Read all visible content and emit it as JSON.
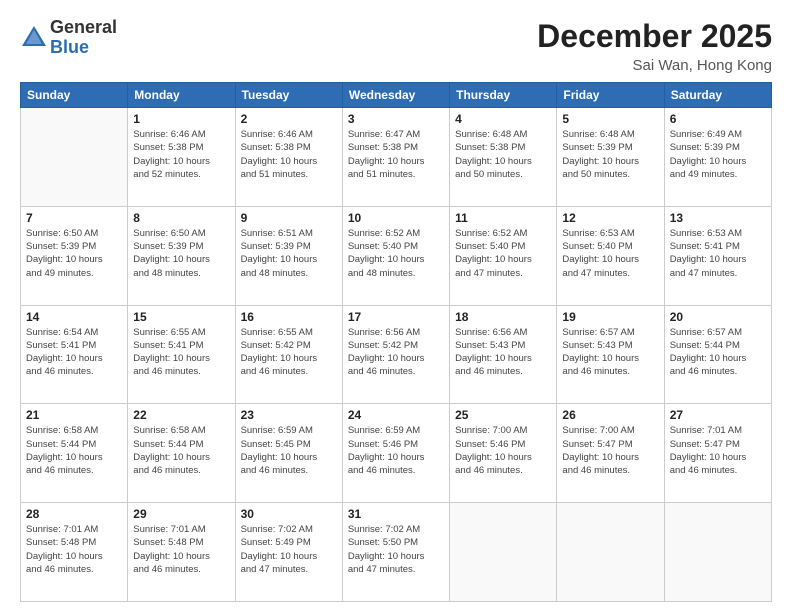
{
  "header": {
    "logo_general": "General",
    "logo_blue": "Blue",
    "month_title": "December 2025",
    "location": "Sai Wan, Hong Kong"
  },
  "calendar": {
    "days_of_week": [
      "Sunday",
      "Monday",
      "Tuesday",
      "Wednesday",
      "Thursday",
      "Friday",
      "Saturday"
    ],
    "weeks": [
      [
        {
          "day": "",
          "info": ""
        },
        {
          "day": "1",
          "info": "Sunrise: 6:46 AM\nSunset: 5:38 PM\nDaylight: 10 hours\nand 52 minutes."
        },
        {
          "day": "2",
          "info": "Sunrise: 6:46 AM\nSunset: 5:38 PM\nDaylight: 10 hours\nand 51 minutes."
        },
        {
          "day": "3",
          "info": "Sunrise: 6:47 AM\nSunset: 5:38 PM\nDaylight: 10 hours\nand 51 minutes."
        },
        {
          "day": "4",
          "info": "Sunrise: 6:48 AM\nSunset: 5:38 PM\nDaylight: 10 hours\nand 50 minutes."
        },
        {
          "day": "5",
          "info": "Sunrise: 6:48 AM\nSunset: 5:39 PM\nDaylight: 10 hours\nand 50 minutes."
        },
        {
          "day": "6",
          "info": "Sunrise: 6:49 AM\nSunset: 5:39 PM\nDaylight: 10 hours\nand 49 minutes."
        }
      ],
      [
        {
          "day": "7",
          "info": "Sunrise: 6:50 AM\nSunset: 5:39 PM\nDaylight: 10 hours\nand 49 minutes."
        },
        {
          "day": "8",
          "info": "Sunrise: 6:50 AM\nSunset: 5:39 PM\nDaylight: 10 hours\nand 48 minutes."
        },
        {
          "day": "9",
          "info": "Sunrise: 6:51 AM\nSunset: 5:39 PM\nDaylight: 10 hours\nand 48 minutes."
        },
        {
          "day": "10",
          "info": "Sunrise: 6:52 AM\nSunset: 5:40 PM\nDaylight: 10 hours\nand 48 minutes."
        },
        {
          "day": "11",
          "info": "Sunrise: 6:52 AM\nSunset: 5:40 PM\nDaylight: 10 hours\nand 47 minutes."
        },
        {
          "day": "12",
          "info": "Sunrise: 6:53 AM\nSunset: 5:40 PM\nDaylight: 10 hours\nand 47 minutes."
        },
        {
          "day": "13",
          "info": "Sunrise: 6:53 AM\nSunset: 5:41 PM\nDaylight: 10 hours\nand 47 minutes."
        }
      ],
      [
        {
          "day": "14",
          "info": "Sunrise: 6:54 AM\nSunset: 5:41 PM\nDaylight: 10 hours\nand 46 minutes."
        },
        {
          "day": "15",
          "info": "Sunrise: 6:55 AM\nSunset: 5:41 PM\nDaylight: 10 hours\nand 46 minutes."
        },
        {
          "day": "16",
          "info": "Sunrise: 6:55 AM\nSunset: 5:42 PM\nDaylight: 10 hours\nand 46 minutes."
        },
        {
          "day": "17",
          "info": "Sunrise: 6:56 AM\nSunset: 5:42 PM\nDaylight: 10 hours\nand 46 minutes."
        },
        {
          "day": "18",
          "info": "Sunrise: 6:56 AM\nSunset: 5:43 PM\nDaylight: 10 hours\nand 46 minutes."
        },
        {
          "day": "19",
          "info": "Sunrise: 6:57 AM\nSunset: 5:43 PM\nDaylight: 10 hours\nand 46 minutes."
        },
        {
          "day": "20",
          "info": "Sunrise: 6:57 AM\nSunset: 5:44 PM\nDaylight: 10 hours\nand 46 minutes."
        }
      ],
      [
        {
          "day": "21",
          "info": "Sunrise: 6:58 AM\nSunset: 5:44 PM\nDaylight: 10 hours\nand 46 minutes."
        },
        {
          "day": "22",
          "info": "Sunrise: 6:58 AM\nSunset: 5:44 PM\nDaylight: 10 hours\nand 46 minutes."
        },
        {
          "day": "23",
          "info": "Sunrise: 6:59 AM\nSunset: 5:45 PM\nDaylight: 10 hours\nand 46 minutes."
        },
        {
          "day": "24",
          "info": "Sunrise: 6:59 AM\nSunset: 5:46 PM\nDaylight: 10 hours\nand 46 minutes."
        },
        {
          "day": "25",
          "info": "Sunrise: 7:00 AM\nSunset: 5:46 PM\nDaylight: 10 hours\nand 46 minutes."
        },
        {
          "day": "26",
          "info": "Sunrise: 7:00 AM\nSunset: 5:47 PM\nDaylight: 10 hours\nand 46 minutes."
        },
        {
          "day": "27",
          "info": "Sunrise: 7:01 AM\nSunset: 5:47 PM\nDaylight: 10 hours\nand 46 minutes."
        }
      ],
      [
        {
          "day": "28",
          "info": "Sunrise: 7:01 AM\nSunset: 5:48 PM\nDaylight: 10 hours\nand 46 minutes."
        },
        {
          "day": "29",
          "info": "Sunrise: 7:01 AM\nSunset: 5:48 PM\nDaylight: 10 hours\nand 46 minutes."
        },
        {
          "day": "30",
          "info": "Sunrise: 7:02 AM\nSunset: 5:49 PM\nDaylight: 10 hours\nand 47 minutes."
        },
        {
          "day": "31",
          "info": "Sunrise: 7:02 AM\nSunset: 5:50 PM\nDaylight: 10 hours\nand 47 minutes."
        },
        {
          "day": "",
          "info": ""
        },
        {
          "day": "",
          "info": ""
        },
        {
          "day": "",
          "info": ""
        }
      ]
    ]
  }
}
